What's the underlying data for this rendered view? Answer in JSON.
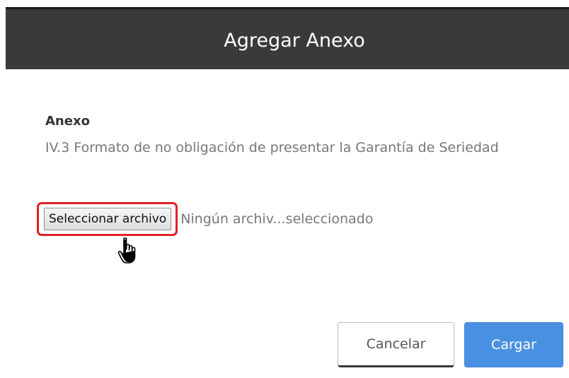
{
  "dialog": {
    "title": "Agregar Anexo"
  },
  "field": {
    "label": "Anexo",
    "description": "IV.3 Formato de no obligación de presentar la Garantía de Seriedad"
  },
  "file_input": {
    "button_label": "Seleccionar archivo",
    "status_text": "Ningún archiv...seleccionado",
    "highlight_color": "#e0202a"
  },
  "cursor": {
    "icon": "hand-pointer-icon"
  },
  "actions": {
    "cancel_label": "Cancelar",
    "submit_label": "Cargar",
    "submit_color": "#4a90e2"
  }
}
